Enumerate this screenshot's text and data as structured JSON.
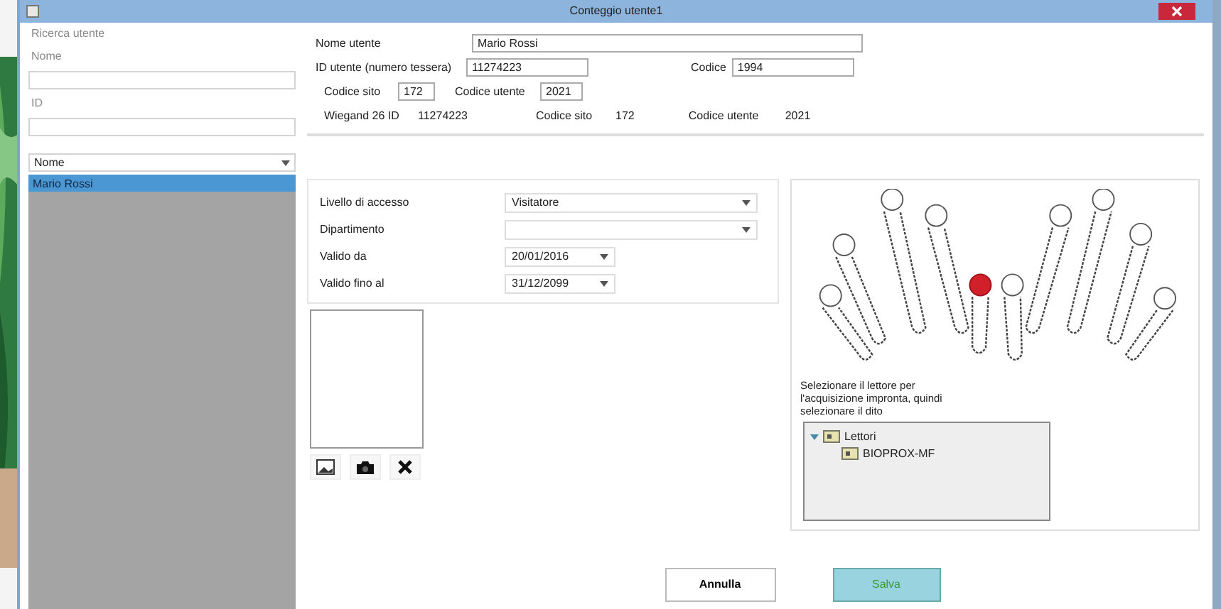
{
  "window": {
    "title": "Conteggio utente1"
  },
  "search": {
    "title": "Ricerca utente",
    "name_label": "Nome",
    "id_label": "ID",
    "sort_by": "Nome"
  },
  "users": [
    {
      "name": "Mario Rossi",
      "selected": true
    }
  ],
  "user": {
    "name_label": "Nome utente",
    "name": "Mario Rossi",
    "id_label": "ID utente (numero tessera)",
    "id": "11274223",
    "code_label": "Codice",
    "code": "1994",
    "site_label": "Codice sito",
    "site": "172",
    "user_code_label": "Codice utente",
    "user_code": "2021"
  },
  "wiegand": {
    "label": "Wiegand 26 ID",
    "id": "11274223",
    "site_label": "Codice sito",
    "site": "172",
    "user_code_label": "Codice utente",
    "user_code": "2021"
  },
  "access": [
    {
      "label": "Livello di accesso",
      "value": "Visitatore",
      "kind": "combo"
    },
    {
      "label": "Dipartimento",
      "kind": "combo"
    },
    {
      "label": "Valido da",
      "value": "20/01/2016",
      "kind": "date"
    },
    {
      "label": "Valido fino al",
      "value": "31/12/2099",
      "kind": "date"
    }
  ],
  "fingers": [
    {
      "enrolled": false
    },
    {
      "enrolled": false
    },
    {
      "enrolled": false
    },
    {
      "enrolled": false
    },
    {
      "enrolled": true
    },
    {
      "enrolled": false
    },
    {
      "enrolled": false
    },
    {
      "enrolled": false
    },
    {
      "enrolled": false
    },
    {
      "enrolled": false
    }
  ],
  "reader_hint": "Selezionare il lettore per l'acquisizione impronta, quindi selezionare il dito",
  "readers": [
    {
      "label": "Lettori",
      "expanded": true,
      "children": [
        {
          "label": "BIOPROX-MF"
        }
      ]
    }
  ],
  "buttons": [
    {
      "label": "Annulla",
      "kind": "cancel"
    },
    {
      "label": "Salva",
      "kind": "primary"
    }
  ]
}
